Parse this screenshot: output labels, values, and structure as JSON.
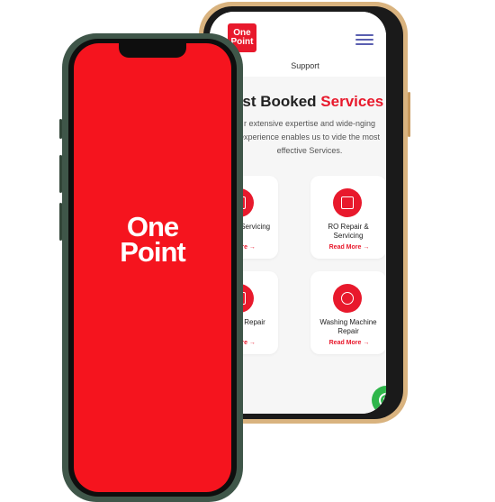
{
  "colors": {
    "brand_red": "#e8192c",
    "whatsapp_green": "#2fb64b",
    "accent_nav": "#5a5fb0"
  },
  "logo": {
    "line1": "One",
    "line2": "Point"
  },
  "mini_logo": {
    "line1": "One",
    "line2": "Point"
  },
  "nav": {
    "support": "Support",
    "menu_icon": "hamburger-icon"
  },
  "hero": {
    "heading_prefix": "ost Booked ",
    "heading_accent": "Services",
    "description": "r extensive expertise and wide-nging experience enables us to vide the most effective Services."
  },
  "services": [
    {
      "title": "Repair & Servicing",
      "link": "d More →",
      "icon": "ac-icon"
    },
    {
      "title": "RO Repair & Servicing",
      "link": "Read More →",
      "icon": "ro-purifier-icon"
    },
    {
      "title": "rigerator Repair",
      "link": "d More →",
      "icon": "refrigerator-icon"
    },
    {
      "title": "Washing Machine Repair",
      "link": "Read More →",
      "icon": "washing-machine-icon"
    }
  ],
  "whatsapp": {
    "icon": "whatsapp-icon"
  }
}
